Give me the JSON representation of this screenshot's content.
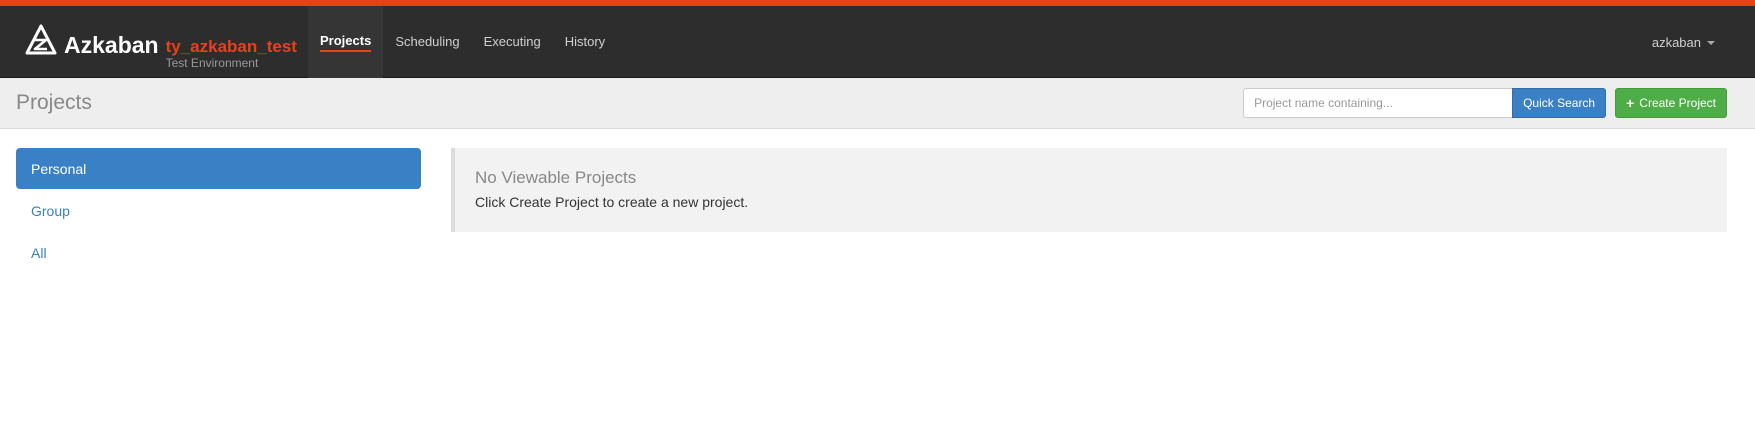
{
  "brand": {
    "name": "Azkaban",
    "env_name": "ty_azkaban_test",
    "env_desc": "Test Environment"
  },
  "nav": {
    "items": [
      {
        "label": "Projects",
        "active": true
      },
      {
        "label": "Scheduling",
        "active": false
      },
      {
        "label": "Executing",
        "active": false
      },
      {
        "label": "History",
        "active": false
      }
    ]
  },
  "user": {
    "name": "azkaban"
  },
  "header": {
    "title": "Projects",
    "search_placeholder": "Project name containing...",
    "search_value": "",
    "quick_search_label": "Quick Search",
    "create_project_label": "Create Project"
  },
  "sidebar": {
    "items": [
      {
        "label": "Personal",
        "active": true
      },
      {
        "label": "Group",
        "active": false
      },
      {
        "label": "All",
        "active": false
      }
    ]
  },
  "main": {
    "title": "No Viewable Projects",
    "message": "Click Create Project to create a new project."
  },
  "colors": {
    "accent": "#e8401c",
    "navbar": "#2d2d2d",
    "primary": "#3a80c4",
    "success": "#4fad47"
  },
  "icons": {
    "brand": "azkaban-logo",
    "user_menu": "caret-down-icon",
    "create": "plus-icon"
  }
}
